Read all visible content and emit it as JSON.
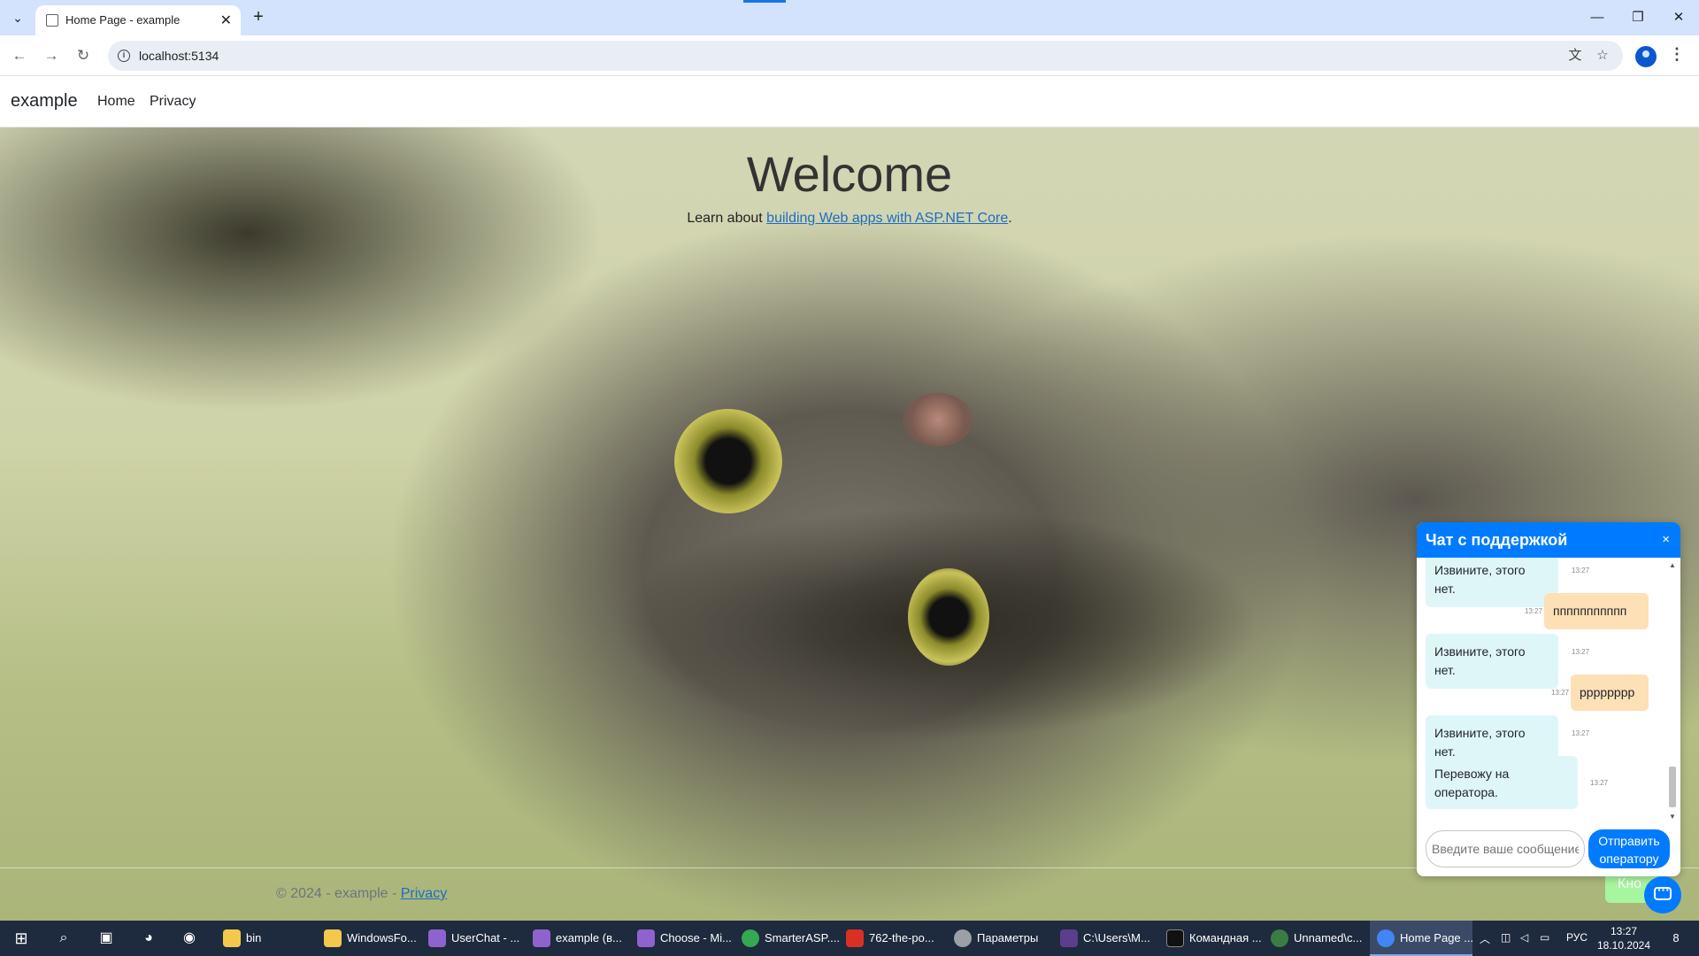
{
  "browser": {
    "tab_title": "Home Page - example",
    "url": "localhost:5134",
    "new_tab_label": "+",
    "window_controls": {
      "minimize": "—",
      "restore": "❐",
      "close": "✕"
    }
  },
  "site": {
    "brand": "example",
    "nav": [
      {
        "label": "Home"
      },
      {
        "label": "Privacy"
      }
    ],
    "hero": {
      "title": "Welcome",
      "lead_prefix": "Learn about ",
      "lead_link": "building Web apps with ASP.NET Core",
      "lead_suffix": "."
    },
    "footer": {
      "text": "© 2024 - example - ",
      "link": "Privacy"
    },
    "side_button_label": "Кно"
  },
  "chat": {
    "title": "Чат с поддержкой",
    "close": "×",
    "messages": [
      {
        "from": "bot",
        "text": "Извините, этого нет.",
        "time": "13:27"
      },
      {
        "from": "user",
        "text": "ппппппппппп",
        "time": "13:27"
      },
      {
        "from": "bot",
        "text": "Извините, этого нет.",
        "time": "13:27"
      },
      {
        "from": "user",
        "text": "pppppppp",
        "time": "13:27"
      },
      {
        "from": "bot",
        "text": "Извините, этого нет.",
        "time": "13:27"
      },
      {
        "from": "bot",
        "text": "Перевожу на оператора.",
        "time": "13:27"
      }
    ],
    "input_placeholder": "Введите ваше сообщение...",
    "send_label": "Отправить оператору"
  },
  "taskbar": {
    "items": [
      {
        "label": "bin",
        "color": "#f2c94c"
      },
      {
        "label": "WindowsFo...",
        "color": "#f2c94c"
      },
      {
        "label": "UserChat - ...",
        "color": "#8e63ce"
      },
      {
        "label": "example (в...",
        "color": "#8e63ce"
      },
      {
        "label": "Choose - Mi...",
        "color": "#8e63ce"
      },
      {
        "label": "SmarterASP....",
        "color": "#34a853"
      },
      {
        "label": "762-the-po...",
        "color": "#d93025"
      },
      {
        "label": "Параметры",
        "color": "#9aa0a6"
      },
      {
        "label": "C:\\Users\\M...",
        "color": "#5b3f8c"
      },
      {
        "label": "Командная ...",
        "color": "#111111"
      },
      {
        "label": "Unnamed\\c...",
        "color": "#3a7d44"
      },
      {
        "label": "Home Page ...",
        "color": "#4285f4"
      }
    ],
    "language": "РУС",
    "time": "13:27",
    "date": "18.10.2024",
    "notifications": "8"
  }
}
